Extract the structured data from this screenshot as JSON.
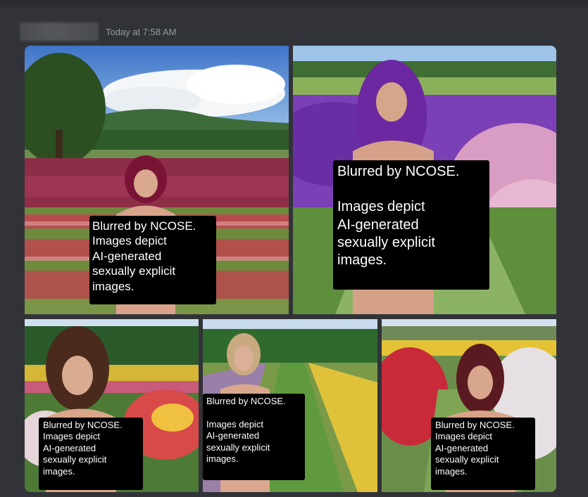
{
  "message": {
    "author": "",
    "timestamp": "Today at 7:58 AM"
  },
  "attachments": [
    {
      "alt": "AI-generated image, woman in red flower field",
      "notice": "Blurred by NCOSE.\nImages depict\nAI-generated\nsexually explicit\nimages."
    },
    {
      "alt": "AI-generated image, woman in purple flower field",
      "notice": "Blurred by NCOSE.\n\nImages depict\nAI-generated\nsexually explicit\nimages."
    },
    {
      "alt": "AI-generated image, woman in multicolor flower field",
      "notice": "Blurred by NCOSE.\nImages depict\nAI-generated\nsexually explicit\nimages."
    },
    {
      "alt": "AI-generated image, woman on path between flower rows",
      "notice": "Blurred by NCOSE.\n\nImages depict\nAI-generated\nsexually explicit\nimages."
    },
    {
      "alt": "AI-generated image, woman in red and white flower field",
      "notice": "Blurred by NCOSE.\nImages depict\nAI-generated\nsexually explicit\nimages."
    }
  ],
  "colors": {
    "background": "#313338",
    "timestamp": "#949ba4",
    "notice_bg": "#000000",
    "notice_text": "#ffffff"
  }
}
